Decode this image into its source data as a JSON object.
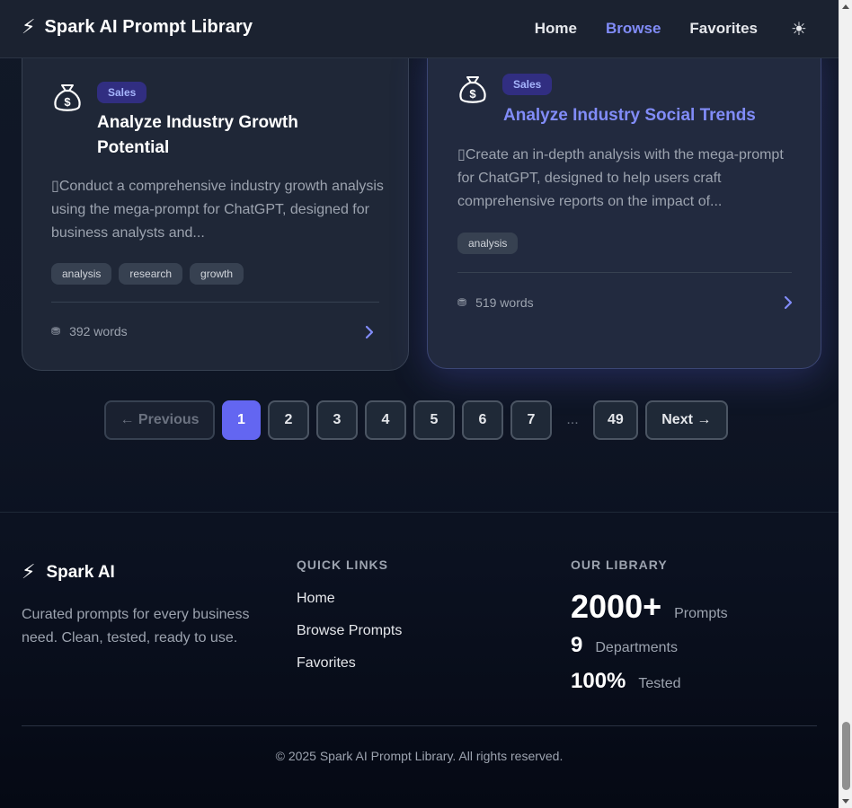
{
  "header": {
    "logo_glyph": "⚡",
    "title": "Spark AI Prompt Library",
    "nav": [
      {
        "label": "Home"
      },
      {
        "label": "Browse"
      },
      {
        "label": "Favorites"
      }
    ],
    "active_nav": "Browse",
    "theme_toggle_glyph": "☀"
  },
  "cards": [
    {
      "icon": "money-bag-icon",
      "category": "Sales",
      "title": "Analyze Industry Growth Potential",
      "description": "Conduct a comprehensive industry growth analysis using the mega-prompt for ChatGPT, designed for business analysts and...",
      "tags": [
        "analysis",
        "research",
        "growth"
      ],
      "word_count": "392 words"
    },
    {
      "icon": "money-bag-icon",
      "category": "Sales",
      "title": "Analyze Industry Social Trends",
      "description": "Create an in-depth analysis with the mega-prompt for ChatGPT, designed to help users craft comprehensive reports on the impact of...",
      "tags": [
        "analysis"
      ],
      "word_count": "519 words"
    }
  ],
  "pagination": {
    "prev_label": "← Previous",
    "next_label": "Next →",
    "pages": [
      "1",
      "2",
      "3",
      "4",
      "5",
      "6",
      "7"
    ],
    "ellipsis": "...",
    "last_page": "49",
    "current": "1"
  },
  "footer": {
    "brand_glyph": "⚡",
    "brand_name": "Spark AI",
    "description": "Curated prompts for every business need. Clean, tested, ready to use.",
    "quick_links_heading": "QUICK LINKS",
    "quick_links": [
      "Home",
      "Browse Prompts",
      "Favorites"
    ],
    "library_heading": "OUR LIBRARY",
    "stats": [
      {
        "value": "2000+",
        "label": "Prompts"
      },
      {
        "value": "9",
        "label": "Departments"
      },
      {
        "value": "100%",
        "label": "Tested"
      }
    ],
    "copyright": "© 2025 Spark AI Prompt Library. All rights reserved."
  },
  "colors": {
    "accent": "#6366f1",
    "accent_text": "#818cf8",
    "background": "#111827"
  }
}
